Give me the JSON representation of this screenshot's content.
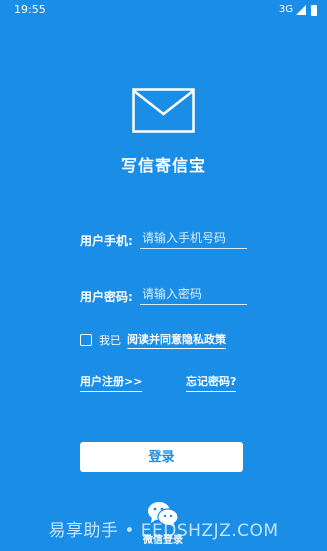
{
  "status": {
    "time": "19:55",
    "network": "3G"
  },
  "app": {
    "title": "写信寄信宝"
  },
  "form": {
    "phone_label": "用户手机:",
    "phone_placeholder": "请输入手机号码",
    "password_label": "用户密码:",
    "password_placeholder": "请输入密码"
  },
  "agreement": {
    "prefix": "我已",
    "link": "阅读并同意隐私政策",
    "checked": false
  },
  "links": {
    "register": "用户注册>>",
    "forgot": "忘记密码?"
  },
  "login_button": "登录",
  "wechat": {
    "label": "微信登录"
  },
  "watermark": "易享助手 • EEDSHZJZ.COM",
  "colors": {
    "background": "#1a8ee6",
    "button_text": "#1a8ee6"
  },
  "icons": [
    "envelope-icon",
    "signal-icon",
    "battery-icon",
    "wechat-icon"
  ]
}
